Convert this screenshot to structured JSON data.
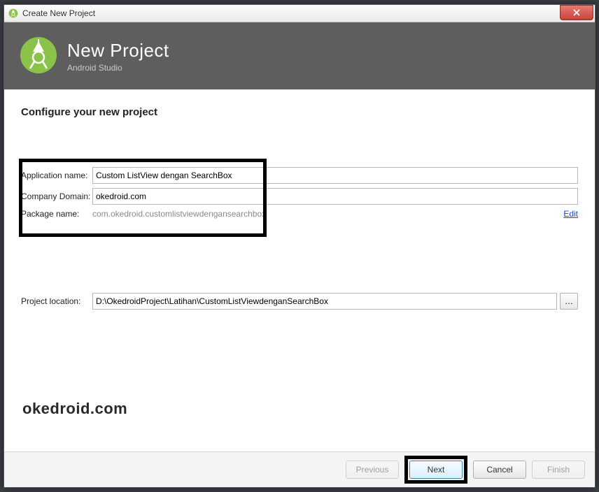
{
  "window": {
    "title": "Create New Project"
  },
  "header": {
    "title": "New Project",
    "subtitle": "Android Studio"
  },
  "section": {
    "heading": "Configure your new project"
  },
  "form": {
    "app_label": "Application name:",
    "app_value": "Custom ListView dengan SearchBox",
    "domain_label": "Company Domain:",
    "domain_value": "okedroid.com",
    "pkg_label": "Package name:",
    "pkg_value": "com.okedroid.customlistviewdengansearchbox",
    "edit_label": "Edit",
    "loc_label": "Project location:",
    "loc_value": "D:\\OkedroidProject\\Latihan\\CustomListViewdenganSearchBox",
    "browse_label": "…"
  },
  "watermark": "okedroid.com",
  "footer": {
    "previous": "Previous",
    "next": "Next",
    "cancel": "Cancel",
    "finish": "Finish"
  }
}
